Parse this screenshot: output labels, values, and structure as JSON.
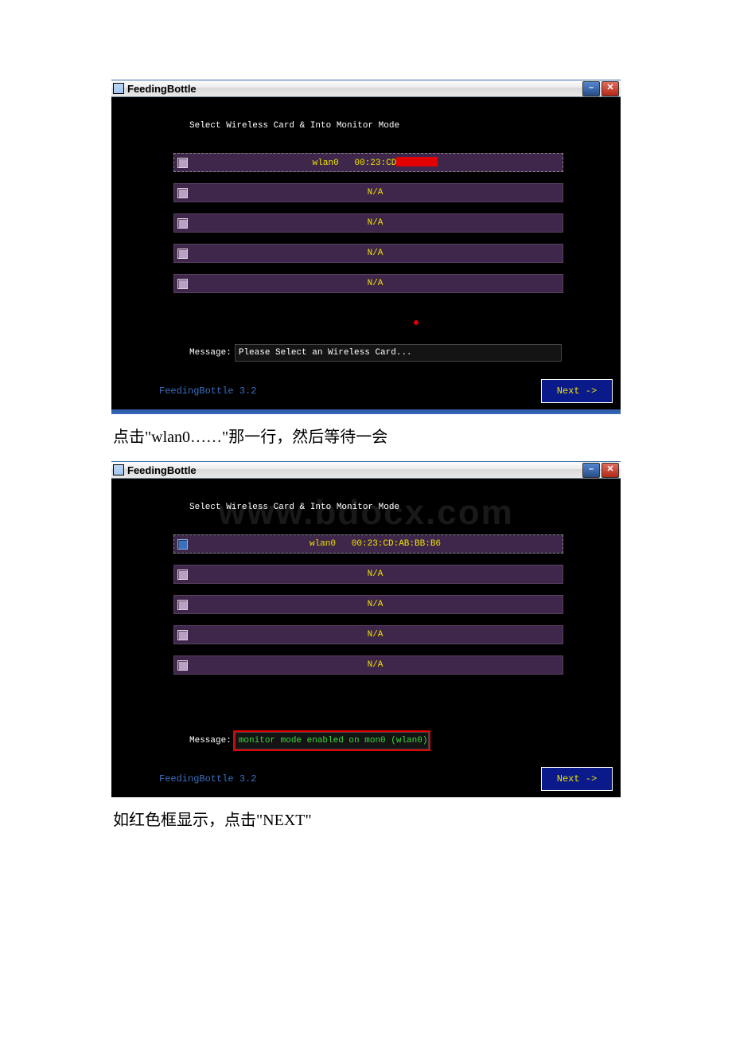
{
  "screenshot1": {
    "window_title": "FeedingBottle",
    "heading": "Select Wireless Card & Into Monitor Mode",
    "rows": {
      "r0_prefix": "wlan0",
      "r0_mac_partial": "00:23:CD",
      "r1": "N/A",
      "r2": "N/A",
      "r3": "N/A",
      "r4": "N/A"
    },
    "message_label": "Message:",
    "message_text": "Please Select an Wireless Card...",
    "brand": "FeedingBottle 3.2",
    "next_label": "Next ->"
  },
  "caption1": "点击\"wlan0……\"那一行，然后等待一会",
  "watermark": "www.bdocx.com",
  "screenshot2": {
    "window_title": "FeedingBottle",
    "heading": "Select Wireless Card & Into Monitor Mode",
    "rows": {
      "r0_prefix": "wlan0",
      "r0_mac": "00:23:CD:AB:BB:B6",
      "r1": "N/A",
      "r2": "N/A",
      "r3": "N/A",
      "r4": "N/A"
    },
    "message_label": "Message:",
    "message_text": "monitor mode enabled on mon0 (wlan0)",
    "brand": "FeedingBottle 3.2",
    "next_label": "Next ->"
  },
  "caption2": "如红色框显示，点击\"NEXT\""
}
